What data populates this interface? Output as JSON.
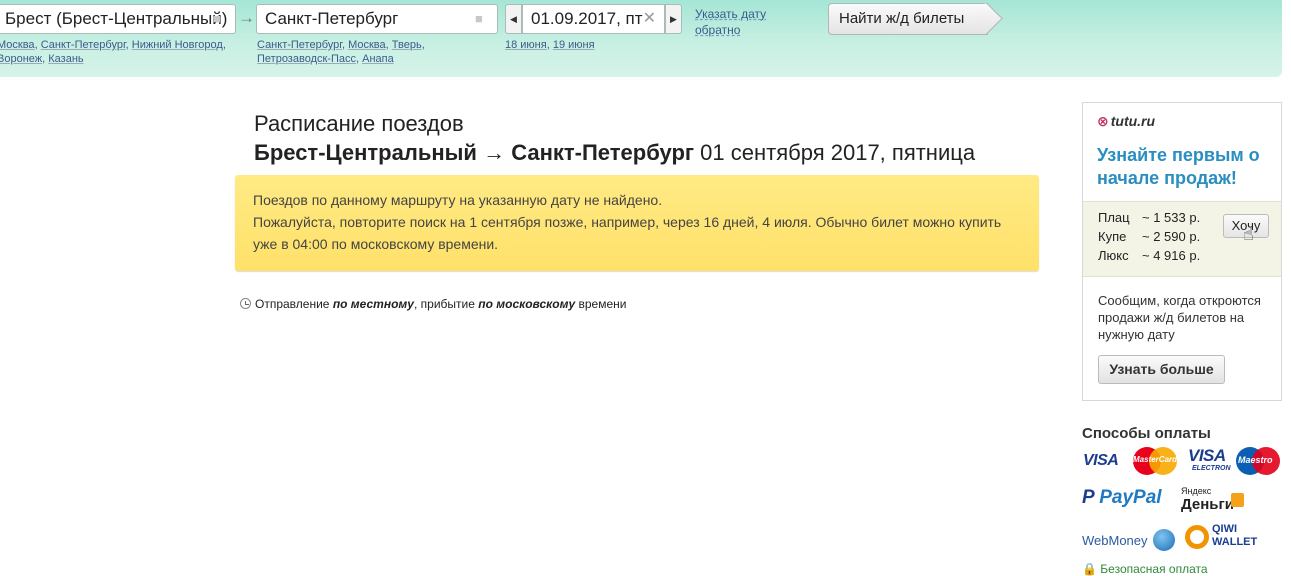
{
  "search": {
    "from_value": "Брест (Брест-Центральный)",
    "to_value": "Санкт-Петербург",
    "date_value": "01.09.2017, пт",
    "from_hints": [
      "Москва",
      "Санкт-Петербург",
      "Нижний Новгород",
      "Воронеж",
      "Казань"
    ],
    "to_hints": [
      "Санкт-Петербург",
      "Москва",
      "Тверь",
      "Петрозаводск-Пасс",
      "Анапа"
    ],
    "date_hints": [
      "18 июня",
      "19 июня"
    ],
    "return_link": "Указать дату обратно",
    "find_button": "Найти ж/д билеты"
  },
  "main": {
    "heading": "Расписание поездов",
    "route_from": "Брест-Центральный",
    "route_arrow": "→",
    "route_to": "Санкт-Петербург",
    "route_date": "01 сентября 2017, пятница",
    "notice_line1": "Поездов по данному маршруту на указанную дату не найдено.",
    "notice_line2": "Пожалуйста, повторите поиск на 1 сентября позже, например, через 16 дней, 4 июля. Обычно билет можно купить уже в 04:00 по московскому времени.",
    "tz_prefix": "Отправление",
    "tz_local": "по местному",
    "tz_mid": ", прибытие",
    "tz_moscow": "по московскому",
    "tz_suffix": "времени"
  },
  "ad": {
    "logo": "tutu.ru",
    "headline": "Узнайте первым о начале продаж!",
    "prices": [
      {
        "label": "Плац",
        "value": "~ 1 533 р."
      },
      {
        "label": "Купе",
        "value": "~ 2 590 р."
      },
      {
        "label": "Люкс",
        "value": "~ 4 916 р."
      }
    ],
    "want_button": "Хочу",
    "text": "Сообщим, когда откроются продажи ж/д билетов на нужную дату",
    "more_button": "Узнать больше"
  },
  "payments": {
    "title": "Способы оплаты",
    "visa": "VISA",
    "mastercard": "MasterCard",
    "visa_electron": "VISA",
    "visa_electron_sub": "ELECTRON",
    "maestro": "Maestro",
    "paypal": "PayPal",
    "yandex_top": "Яндекс",
    "yandex_bottom": "Деньги",
    "webmoney": "WebMoney",
    "qiwi_top": "QIWI",
    "qiwi_bottom": "WALLET",
    "secure": "Безопасная оплата"
  }
}
